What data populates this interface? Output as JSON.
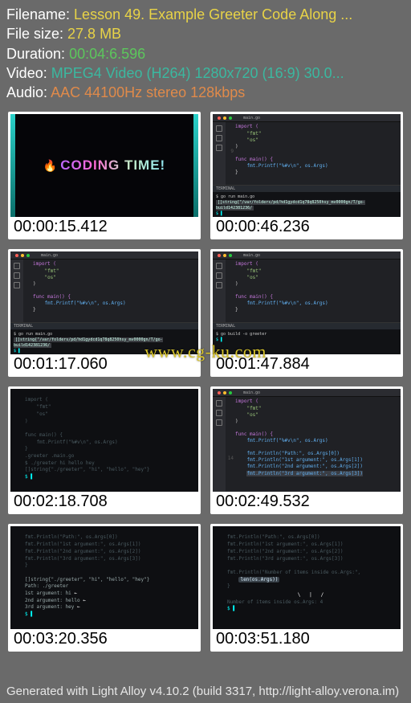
{
  "meta": {
    "filename_label": "Filename:",
    "filename": "Lesson 49. Example Greeter Code Along ...",
    "filesize_label": "File size:",
    "filesize": "27.8 MB",
    "duration_label": "Duration:",
    "duration": "00:04:6.596",
    "video_label": "Video:",
    "video": "MPEG4 Video (H264) 1280x720 (16:9) 30.0...",
    "audio_label": "Audio:",
    "audio": "AAC 44100Hz stereo 128kbps"
  },
  "watermark": "www.cg-ku.com",
  "footer": "Generated with Light Alloy v4.10.2 (build 3317, http://light-alloy.verona.im)",
  "thumbs": [
    {
      "timestamp": "00:00:15.412",
      "title": "CODING TIME!"
    },
    {
      "timestamp": "00:00:46.236"
    },
    {
      "timestamp": "00:01:17.060"
    },
    {
      "timestamp": "00:01:47.884"
    },
    {
      "timestamp": "00:02:18.708"
    },
    {
      "timestamp": "00:02:49.532"
    },
    {
      "timestamp": "00:03:20.356"
    },
    {
      "timestamp": "00:03:51.180"
    }
  ],
  "code": {
    "tab": "main.go",
    "import": "import (",
    "fmt": "\"fmt\"",
    "os": "\"os\"",
    "close": ")",
    "funcmain": "func main() {",
    "printf": "fmt.Printf(\"%#v\\n\", os.Args)",
    "line9": "9",
    "line14": "14",
    "path_line": "fmt.Println(\"Path:\", os.Args[0])",
    "arg1_line": "fmt.Println(\"1st argument:\", os.Args[1])",
    "arg2_line": "fmt.Println(\"2nd argument:\", os.Args[2])",
    "arg3_line": "fmt.Println(\"3rd argument:\", os.Args[3])",
    "num_line": "fmt.Println(\"Number of items inside os.Args:\",",
    "len_line": "len(os.Args))",
    "term_run": "$ go run main.go",
    "term_build": "$ go build -o greeter",
    "term_path_hl": "[]string{\"/var/folders/pd/hd1gydcd1q78q8250hsy_mv0000gn/T/go-build142381236/",
    "greeter_str": "[]string{\"./greeter\", \"hi\", \"hello\", \"hey\"}",
    "greet_cmd": "$ ./greeter hi hello hey",
    "out_path": "Path: ./greeter",
    "out1": "1st argument: hi",
    "out2": "2nd argument: hello",
    "out3": "3rd argument: hey",
    "out_num": "Number of items inside os.Args: 4"
  }
}
